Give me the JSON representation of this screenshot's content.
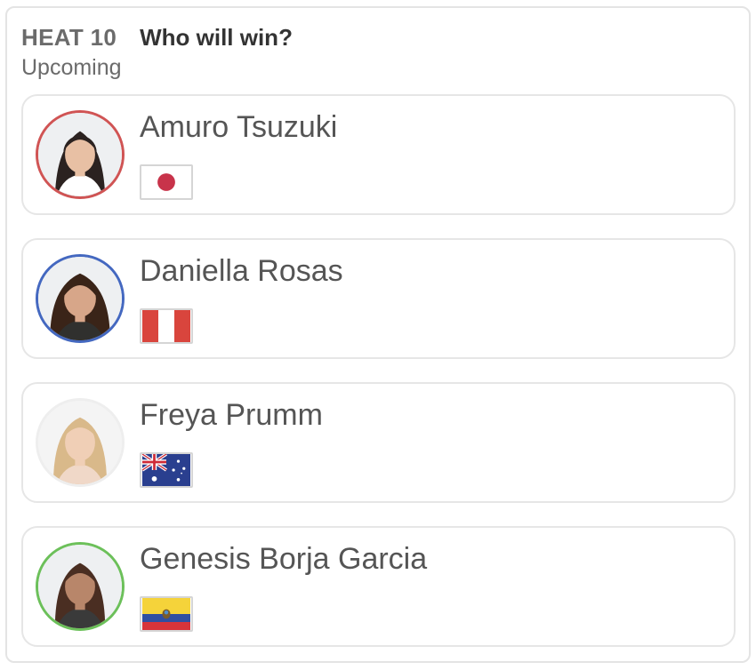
{
  "heat": {
    "label": "HEAT 10",
    "question": "Who will win?",
    "status": "Upcoming"
  },
  "surfers": [
    {
      "name": "Amuro Tsuzuki",
      "country_flag": "japan-flag",
      "ring_color": "#d05454",
      "avatar": "surfer-photo"
    },
    {
      "name": "Daniella Rosas",
      "country_flag": "peru-flag",
      "ring_color": "#4468c0",
      "avatar": "surfer-photo"
    },
    {
      "name": "Freya Prumm",
      "country_flag": "australia-flag",
      "ring_color": "#eeeeee",
      "avatar": "surfer-photo"
    },
    {
      "name": "Genesis Borja Garcia",
      "country_flag": "ecuador-flag",
      "ring_color": "#6cc05a",
      "avatar": "surfer-photo"
    }
  ]
}
